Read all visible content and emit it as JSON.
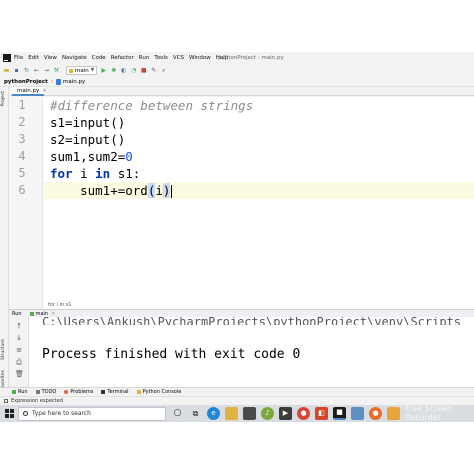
{
  "window": {
    "title": "pythonProject - main.py"
  },
  "menu": [
    "File",
    "Edit",
    "View",
    "Navigate",
    "Code",
    "Refactor",
    "Run",
    "Tools",
    "VCS",
    "Window",
    "Help"
  ],
  "toolbar": {
    "branch": "main"
  },
  "breadcrumb": {
    "project": "pythonProject",
    "file": "main.py"
  },
  "tabs": [
    {
      "label": "main.py"
    }
  ],
  "editor": {
    "line_numbers": [
      "1",
      "2",
      "3",
      "4",
      "5",
      "6"
    ],
    "lines": [
      {
        "tokens": [
          {
            "t": "#difference between strings",
            "c": "comment"
          }
        ]
      },
      {
        "tokens": [
          {
            "t": "s1=input()",
            "c": ""
          }
        ]
      },
      {
        "tokens": [
          {
            "t": "s2=input()",
            "c": ""
          }
        ]
      },
      {
        "tokens": [
          {
            "t": "sum1,sum2=",
            "c": ""
          },
          {
            "t": "0",
            "c": "num"
          }
        ]
      },
      {
        "tokens": [
          {
            "t": "for",
            "c": "kw"
          },
          {
            "t": " i ",
            "c": ""
          },
          {
            "t": "in",
            "c": "kw"
          },
          {
            "t": " s1:",
            "c": ""
          }
        ]
      },
      {
        "tokens": [
          {
            "t": "    sum1+=ord",
            "c": ""
          },
          {
            "t": "(",
            "c": "paren"
          },
          {
            "t": "i",
            "c": ""
          },
          {
            "t": ")",
            "c": "paren"
          }
        ]
      }
    ],
    "context": "for i in s1"
  },
  "run": {
    "tab_label": "Run",
    "config": "main",
    "command_partial": "C:\\Users\\Ankush\\PycharmProjects\\pythonProject\\venv\\Scripts",
    "output": "Process finished with exit code 0"
  },
  "side_tools": {
    "project": "Project",
    "structure": "Structure",
    "favorites": "Favorites"
  },
  "bottom_tabs": [
    "Run",
    "TODO",
    "Problems",
    "Terminal",
    "Python Console"
  ],
  "status": {
    "message": "Expression expected"
  },
  "taskbar": {
    "search_placeholder": "Type here to search"
  },
  "watermark": "Free Screen Recorder"
}
